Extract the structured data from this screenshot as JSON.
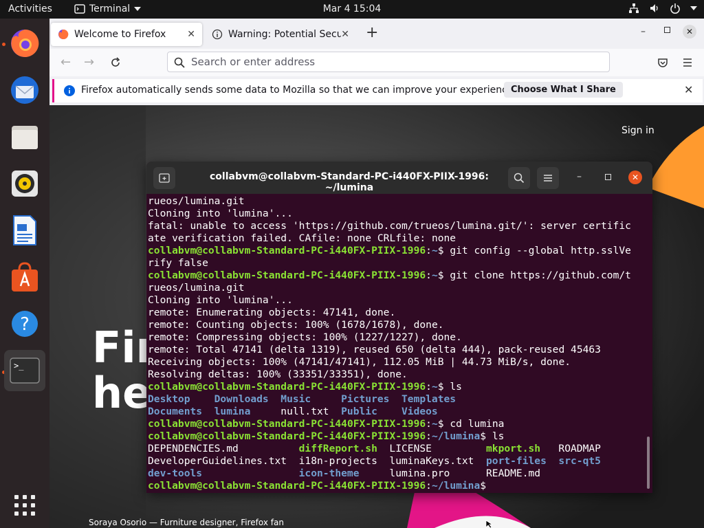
{
  "topbar": {
    "activities": "Activities",
    "app_name": "Terminal",
    "clock": "Mar 4  15:04"
  },
  "dock": {
    "items": [
      "firefox",
      "thunderbird",
      "files",
      "rhythmbox",
      "libreoffice-writer",
      "ubuntu-software",
      "help",
      "terminal"
    ]
  },
  "firefox": {
    "tabs": [
      {
        "label": "Welcome to Firefox"
      },
      {
        "label": "Warning: Potential Security Risk Ahead"
      }
    ],
    "url_placeholder": "Search or enter address",
    "notification": {
      "text": "Firefox automatically sends some data to Mozilla so that we can improve your experience.",
      "button": "Choose What I Share"
    },
    "page": {
      "sign_in": "Sign in",
      "hero_line1": "Fir",
      "hero_line2": "he",
      "caption": "Soraya Osorio — Furniture designer, Firefox fan"
    }
  },
  "terminal": {
    "title": "collabvm@collabvm-Standard-PC-i440FX-PIIX-1996: ~/lumina",
    "prompt_home": "collabvm@collabvm-Standard-PC-i440FX-PIIX-1996",
    "lines": [
      {
        "plain": "rueos/lumina.git"
      },
      {
        "plain": "Cloning into 'lumina'..."
      },
      {
        "plain": "fatal: unable to access 'https://github.com/trueos/lumina.git/': server certific"
      },
      {
        "plain": "ate verification failed. CAfile: none CRLfile: none"
      },
      {
        "prompt": "collabvm@collabvm-Standard-PC-i440FX-PIIX-1996",
        "path": "~",
        "cmd": "git config --global http.sslVe"
      },
      {
        "plain": "rify false"
      },
      {
        "prompt": "collabvm@collabvm-Standard-PC-i440FX-PIIX-1996",
        "path": "~",
        "cmd": "git clone https://github.com/t"
      },
      {
        "plain": "rueos/lumina.git"
      },
      {
        "plain": "Cloning into 'lumina'..."
      },
      {
        "plain": "remote: Enumerating objects: 47141, done."
      },
      {
        "plain": "remote: Counting objects: 100% (1678/1678), done."
      },
      {
        "plain": "remote: Compressing objects: 100% (1227/1227), done."
      },
      {
        "plain": "remote: Total 47141 (delta 1319), reused 650 (delta 444), pack-reused 45463"
      },
      {
        "plain": "Receiving objects: 100% (47141/47141), 112.05 MiB | 44.73 MiB/s, done."
      },
      {
        "plain": "Resolving deltas: 100% (33351/33351), done."
      },
      {
        "prompt": "collabvm@collabvm-Standard-PC-i440FX-PIIX-1996",
        "path": "~",
        "cmd": "ls"
      },
      {
        "cols": [
          [
            "Desktop",
            "b"
          ],
          [
            "Downloads",
            "b"
          ],
          [
            "Music",
            "b"
          ],
          [
            "Pictures",
            "b"
          ],
          [
            "Templates",
            "b"
          ]
        ]
      },
      {
        "cols": [
          [
            "Documents",
            "b"
          ],
          [
            "lumina",
            "b"
          ],
          [
            "null.txt",
            "w"
          ],
          [
            "Public",
            "b"
          ],
          [
            "Videos",
            "b"
          ]
        ]
      },
      {
        "prompt": "collabvm@collabvm-Standard-PC-i440FX-PIIX-1996",
        "path": "~",
        "cmd": "cd lumina"
      },
      {
        "prompt": "collabvm@collabvm-Standard-PC-i440FX-PIIX-1996",
        "path": "~/lumina",
        "cmd": "ls"
      },
      {
        "cols2": [
          [
            "DEPENDENCIES.md",
            "w"
          ],
          [
            "diffReport.sh",
            "g"
          ],
          [
            "LICENSE",
            "w"
          ],
          [
            "mkport.sh",
            "g"
          ],
          [
            "ROADMAP",
            "w"
          ]
        ]
      },
      {
        "cols2": [
          [
            "DeveloperGuidelines.txt",
            "w"
          ],
          [
            "i18n-projects",
            "w"
          ],
          [
            "luminaKeys.txt",
            "w"
          ],
          [
            "port-files",
            "b"
          ],
          [
            "src-qt5",
            "b"
          ]
        ]
      },
      {
        "cols2": [
          [
            "dev-tools",
            "b"
          ],
          [
            "icon-theme",
            "b"
          ],
          [
            "lumina.pro",
            "w"
          ],
          [
            "README.md",
            "w"
          ],
          [
            "",
            "w"
          ]
        ]
      },
      {
        "prompt": "collabvm@collabvm-Standard-PC-i440FX-PIIX-1996",
        "path": "~/lumina",
        "cmd": ""
      }
    ]
  }
}
